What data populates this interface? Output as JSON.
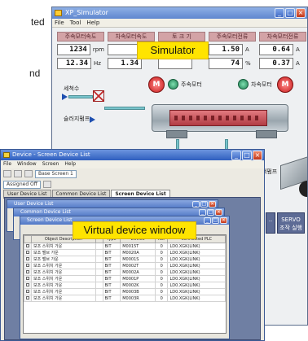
{
  "page_text": {
    "line1": "ted",
    "line2": "nd"
  },
  "simulator": {
    "title": "XP_Simulator",
    "menu": [
      "File",
      "Tool",
      "Help"
    ],
    "readouts": [
      {
        "header": "주속모터속도",
        "rows": [
          {
            "value": "1234",
            "unit": "rpm"
          },
          {
            "value": "12.34",
            "unit": "Hz"
          }
        ]
      },
      {
        "header": "차속모터속도",
        "rows": [
          {
            "value": "",
            "unit": ""
          },
          {
            "value": "1.34",
            "unit": ""
          }
        ]
      },
      {
        "header": "토 크 기",
        "rows": [
          {
            "value": "",
            "unit": ""
          },
          {
            "value": "",
            "unit": ""
          }
        ]
      },
      {
        "header": "주속모터전류",
        "rows": [
          {
            "value": "1.50",
            "unit": "A"
          },
          {
            "value": "74",
            "unit": "%"
          }
        ]
      },
      {
        "header": "차속모터전류",
        "rows": [
          {
            "value": "0.64",
            "unit": "A"
          },
          {
            "value": "0.37",
            "unit": "A"
          }
        ]
      }
    ],
    "overlay_label": "Simulator",
    "diagram": {
      "main_motor_label": "주속모터",
      "sub_motor_label": "차속모터",
      "motor_symbol": "M",
      "feed_label": "세척수",
      "sludge_label": "슬러지펌프",
      "cake_label": "탈리액펌프"
    },
    "side_button": {
      "line1": "SERVO",
      "line2": "조작 실행"
    }
  },
  "device": {
    "title": "Device - Screen Device List",
    "menu": [
      "File",
      "Window",
      "Screen",
      "Help"
    ],
    "toolbar_combo": "Base Screen 1",
    "toolbar_combo2": "Assigned Off",
    "tabs": [
      "User Device List",
      "Common Device List",
      "Screen Device List"
    ],
    "child_windows": [
      "User Device List",
      "Common Device List",
      "Screen Device List"
    ],
    "overlay_label": "Virtual device window",
    "columns": [
      "",
      "Object Description",
      "",
      "Type",
      "Device",
      "No.",
      "Connected PLC"
    ],
    "rows": [
      [
        "",
        "보조 스위치 가운",
        "",
        "BIT",
        "M0015T",
        "0",
        "LD0.XGK(LINK)"
      ],
      [
        "",
        "보조 밸브 가운",
        "",
        "BIT",
        "M0020A",
        "0",
        "LD0.XGK(LINK)"
      ],
      [
        "",
        "보조 밸브 가운",
        "",
        "BIT",
        "M0001S",
        "0",
        "LD0.XGK(LINK)"
      ],
      [
        "",
        "보조 스위치 가운",
        "",
        "BIT",
        "M0002T",
        "0",
        "LD0.XGK(LINK)"
      ],
      [
        "",
        "보조 스위치 가운",
        "",
        "BIT",
        "M0002A",
        "0",
        "LD0.XGK(LINK)"
      ],
      [
        "",
        "보조 스위치 가운",
        "",
        "BIT",
        "M0001P",
        "0",
        "LD0.XGK(LINK)"
      ],
      [
        "",
        "보조 스위치 가운",
        "",
        "BIT",
        "M0002K",
        "0",
        "LD0.XGK(LINK)"
      ],
      [
        "",
        "보조 스위치 가운",
        "",
        "BIT",
        "M0003B",
        "0",
        "LD0.XGK(LINK)"
      ],
      [
        "",
        "보조 스위치 가운",
        "",
        "BIT",
        "M0003R",
        "0",
        "LD0.XGK(LINK)"
      ]
    ]
  }
}
